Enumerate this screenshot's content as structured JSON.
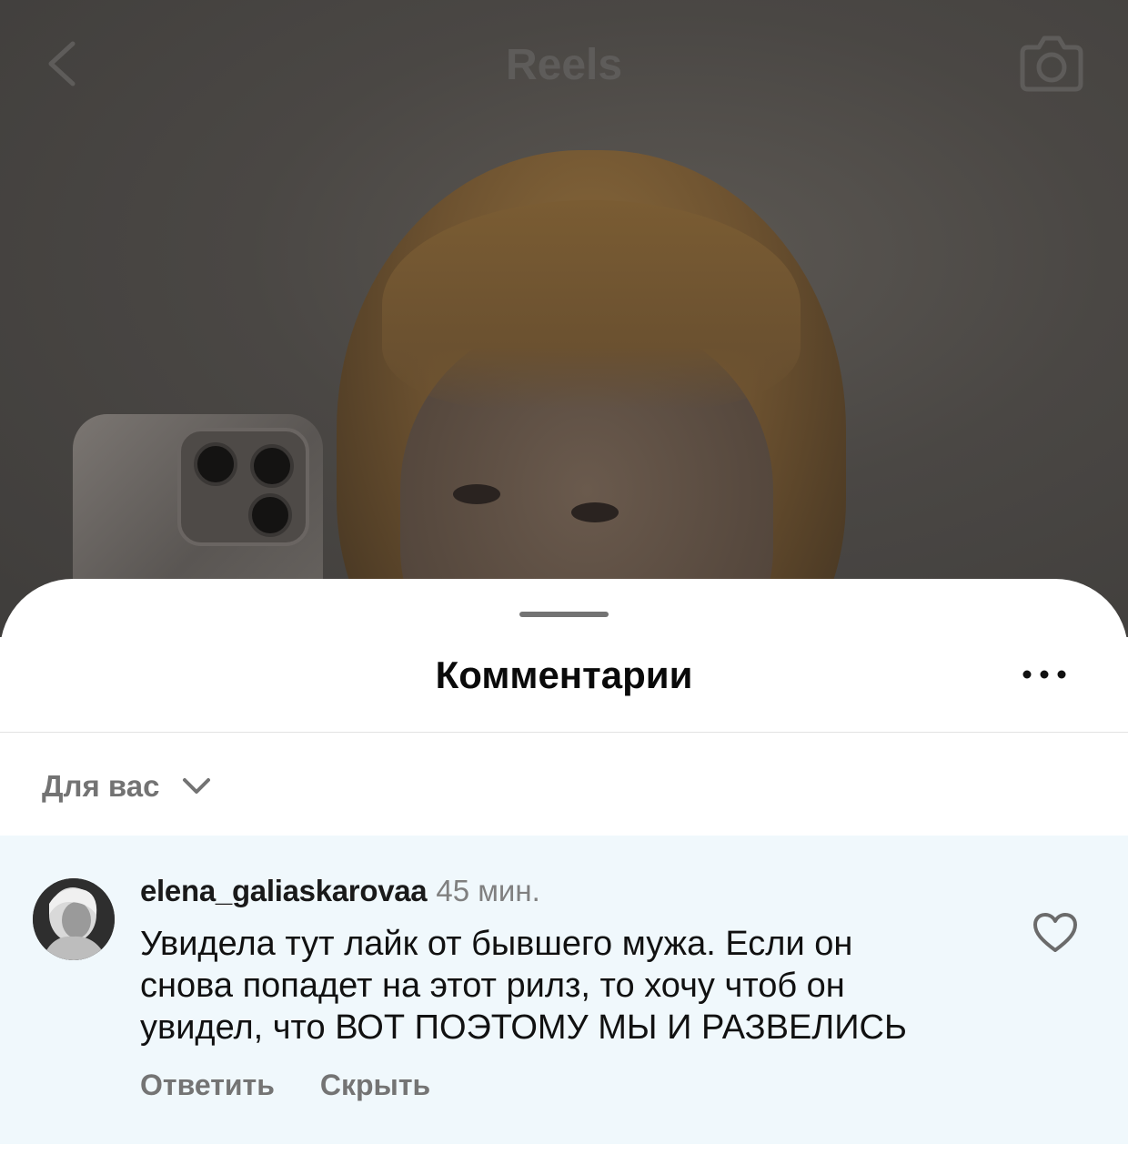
{
  "header": {
    "title": "Reels",
    "back_icon": "chevron-left-icon",
    "camera_icon": "camera-icon"
  },
  "sheet": {
    "title": "Комментарии",
    "more_icon": "ellipsis-icon",
    "sort": {
      "selected": "Для вас",
      "icon": "chevron-down-icon"
    },
    "comments": [
      {
        "username": "elena_galiaskarovaa",
        "time": "45 мин.",
        "text_lines": [
          "Увидела тут лайк от бывшего мужа. Если он",
          "снова попадет на этот рилз, то хочу чтоб он",
          "увидел, что ВОТ ПОЭТОМУ МЫ И РАЗВЕЛИСЬ"
        ],
        "reply_label": "Ответить",
        "hide_label": "Скрыть",
        "like_icon": "heart-icon",
        "highlight_color": "#f0f8fc"
      }
    ]
  }
}
